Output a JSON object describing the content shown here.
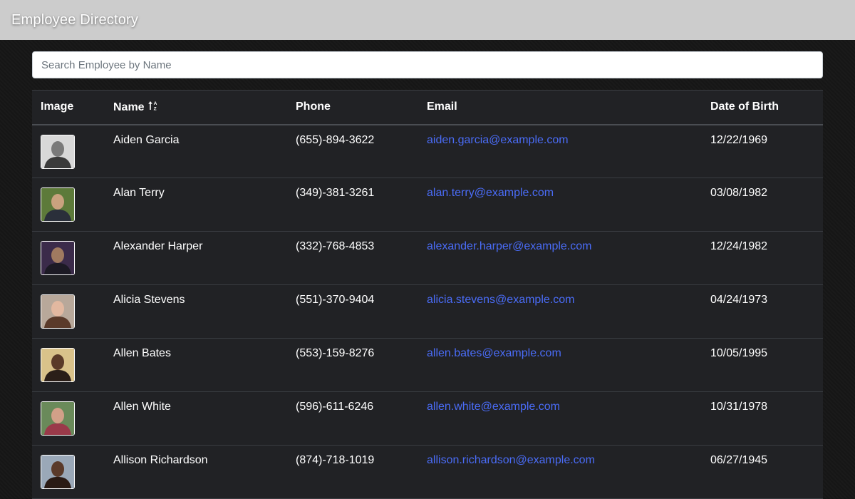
{
  "header": {
    "title": "Employee Directory"
  },
  "search": {
    "placeholder": "Search Employee by Name",
    "value": ""
  },
  "table": {
    "columns": {
      "image": "Image",
      "name": "Name",
      "phone": "Phone",
      "email": "Email",
      "dob": "Date of Birth"
    },
    "sort": {
      "column": "name",
      "icon": "sort-alpha-up-icon"
    },
    "rows": [
      {
        "name": "Aiden Garcia",
        "phone": "(655)-894-3622",
        "email": "aiden.garcia@example.com",
        "dob": "12/22/1969",
        "avatar_colors": [
          "#d8d8d8",
          "#7a7a7a",
          "#3a3a3a"
        ]
      },
      {
        "name": "Alan Terry",
        "phone": "(349)-381-3261",
        "email": "alan.terry@example.com",
        "dob": "03/08/1982",
        "avatar_colors": [
          "#5d7a3a",
          "#c9a27e",
          "#2a2f3a"
        ]
      },
      {
        "name": "Alexander Harper",
        "phone": "(332)-768-4853",
        "email": "alexander.harper@example.com",
        "dob": "12/24/1982",
        "avatar_colors": [
          "#3b2b4a",
          "#a07a60",
          "#1c1a24"
        ]
      },
      {
        "name": "Alicia Stevens",
        "phone": "(551)-370-9404",
        "email": "alicia.stevens@example.com",
        "dob": "04/24/1973",
        "avatar_colors": [
          "#b8a89a",
          "#e2b8a0",
          "#5a3a2a"
        ]
      },
      {
        "name": "Allen Bates",
        "phone": "(553)-159-8276",
        "email": "allen.bates@example.com",
        "dob": "10/05/1995",
        "avatar_colors": [
          "#d9c28a",
          "#5a3a28",
          "#2a1e18"
        ]
      },
      {
        "name": "Allen White",
        "phone": "(596)-611-6246",
        "email": "allen.white@example.com",
        "dob": "10/31/1978",
        "avatar_colors": [
          "#6a8a5a",
          "#d2a088",
          "#9a3a4a"
        ]
      },
      {
        "name": "Allison Richardson",
        "phone": "(874)-718-1019",
        "email": "allison.richardson@example.com",
        "dob": "06/27/1945",
        "avatar_colors": [
          "#9aa8b8",
          "#5a3a2a",
          "#2a1a14"
        ]
      }
    ]
  },
  "colors": {
    "header_bg": "#cccccc",
    "page_bg": "#161616",
    "table_bg": "#212225",
    "link": "#4a6cf7",
    "text": "#ffffff"
  }
}
